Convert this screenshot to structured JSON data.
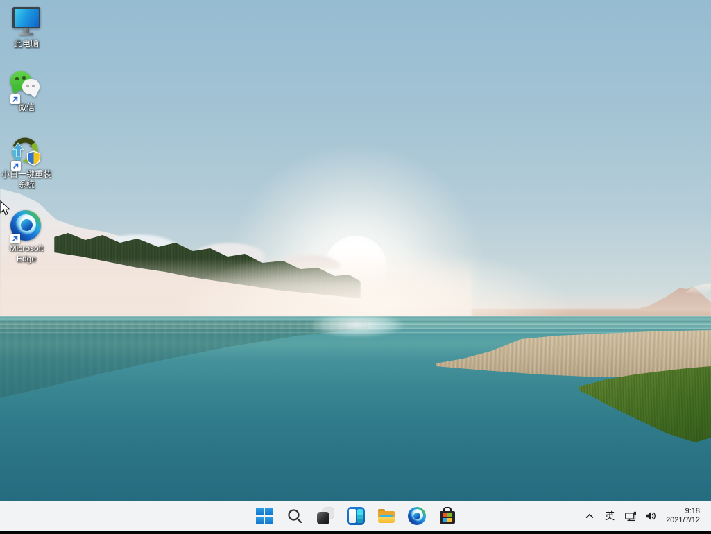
{
  "desktop": {
    "icons": [
      {
        "id": "this-pc",
        "label": "此电脑",
        "shortcut": false
      },
      {
        "id": "wechat",
        "label": "微信",
        "shortcut": true
      },
      {
        "id": "xiaobai-reinstall",
        "label": "小白一键重装系统",
        "shortcut": true
      },
      {
        "id": "microsoft-edge",
        "label": "Microsoft Edge",
        "shortcut": true
      }
    ]
  },
  "taskbar": {
    "buttons": [
      {
        "icon": "windows-start-icon"
      },
      {
        "icon": "search-icon"
      },
      {
        "icon": "task-view-icon"
      },
      {
        "icon": "widgets-icon"
      },
      {
        "icon": "file-explorer-icon"
      },
      {
        "icon": "edge-icon"
      },
      {
        "icon": "microsoft-store-icon"
      }
    ],
    "tray": {
      "chevron_icon": "chevron-up-icon",
      "ime_label": "英",
      "network_icon": "network-icon",
      "volume_icon": "volume-icon",
      "time": "9:18",
      "date": "2021/7/12"
    }
  },
  "colors": {
    "accent_blue": "#0f78d7",
    "taskbar_bg": "#f2f3f5",
    "water_teal": "#35818f",
    "sky_blue": "#a3c3d4"
  }
}
